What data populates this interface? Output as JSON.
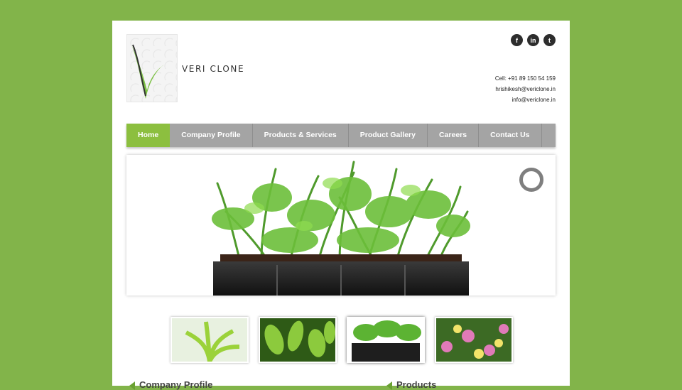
{
  "brand": {
    "name": "VERI CLONE",
    "logo": "vericlone-logo"
  },
  "social": [
    {
      "name": "facebook-icon",
      "glyph": "f"
    },
    {
      "name": "linkedin-icon",
      "glyph": "in"
    },
    {
      "name": "twitter-icon",
      "glyph": "t"
    }
  ],
  "contact": {
    "cell": "Cell: +91 89 150 54 159",
    "email1": "hrishikesh@vericlone.in",
    "email2": "info@vericlone.in"
  },
  "nav": [
    {
      "label": "Home",
      "active": true
    },
    {
      "label": "Company Profile"
    },
    {
      "label": "Products & Services"
    },
    {
      "label": "Product Gallery"
    },
    {
      "label": "Careers"
    },
    {
      "label": "Contact Us"
    }
  ],
  "sections": {
    "left": "Company Profile",
    "right": "Products"
  },
  "colors": {
    "background": "#82b44a",
    "nav": "#a4a4a4",
    "active": "#8cbf3f"
  }
}
